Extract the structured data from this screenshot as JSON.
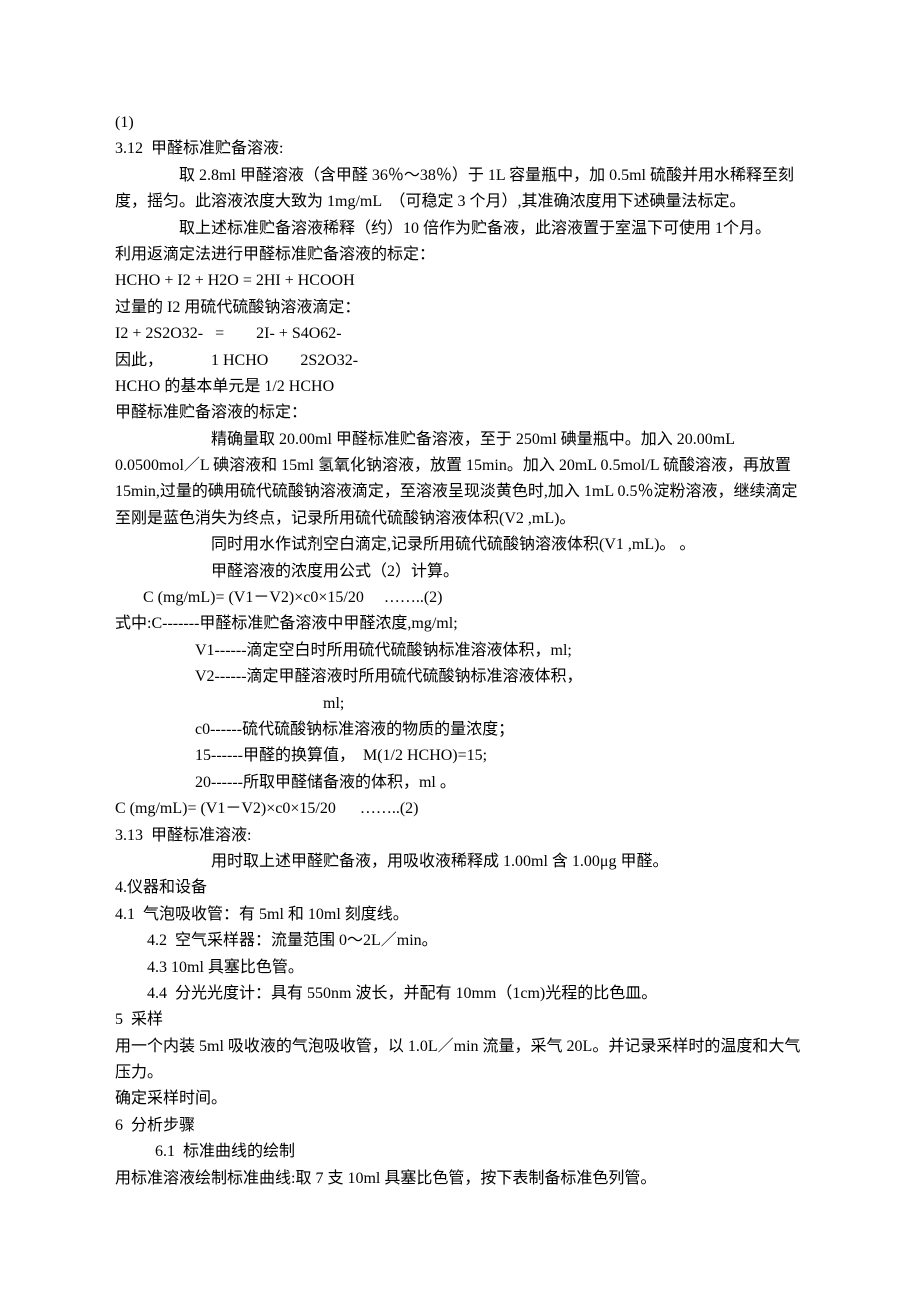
{
  "lines": {
    "l0": "(1)",
    "l1": "3.12  甲醛标准贮备溶液:",
    "l2": "　　　　取 2.8ml 甲醛溶液（含甲醛 36％～38％）于 1L 容量瓶中，加 0.5ml 硫酸并用水稀释至刻度，摇匀。此溶液浓度大致为 1mg/mL  （可稳定 3 个月）,其准确浓度用下述碘量法标定。",
    "l3": "",
    "l4": "　　　　取上述标准贮备溶液稀释（约）10 倍作为贮备液，此溶液置于室温下可使用 1个月。",
    "l5": "利用返滴定法进行甲醛标准贮备溶液的标定：",
    "l6": "HCHO + I2 + H2O = 2HI + HCOOH",
    "l7": "过量的 I2 用硫代硫酸钠溶液滴定：",
    "l8": "I2 + 2S2O32-   =        2I- + S4O62-",
    "l9": "因此，            1 HCHO        2S2O32-",
    "l10": "HCHO 的基本单元是 1/2 HCHO",
    "l11": "甲醛标准贮备溶液的标定：",
    "l12": "　　　　　　精确量取 20.00ml 甲醛标准贮备溶液，至于 250ml 碘量瓶中。加入 20.00mL 0.0500mol／L 碘溶液和 15ml 氢氧化钠溶液，放置 15min。加入 20mL 0.5mol/L 硫酸溶液，再放置 15min,过量的碘用硫代硫酸钠溶液滴定，至溶液呈现淡黄色时,加入 1mL 0.5％淀粉溶液，继续滴定至刚是蓝色消失为终点，记录所用硫代硫酸钠溶液体积(V2 ,mL)。",
    "l13": "　　　　　　同时用水作试剂空白滴定,记录所用硫代硫酸钠溶液体积(V1 ,mL)。 。",
    "l14": "　　　　　　甲醛溶液的浓度用公式（2）计算。",
    "l15": "       C (mg/mL)= (V1－V2)×c0×15/20     ……..(2)",
    "l16": "式中:C-------甲醛标准贮备溶液中甲醛浓度,mg/ml;",
    "l17": "　　　　　V1------滴定空白时所用硫代硫酸钠标准溶液体积，ml;",
    "l18": "　　　　　V2------滴定甲醛溶液时所用硫代硫酸钠标准溶液体积，",
    "l19": "　　　　　　　　　　　　　ml;",
    "l20": "　　　　　c0------硫代硫酸钠标准溶液的物质的量浓度；",
    "l21": "　　　　　15------甲醛的换算值，  M(1/2 HCHO)=15;",
    "l22": "　　　　　20------所取甲醛储备液的体积，ml 。",
    "l23": "C (mg/mL)= (V1－V2)×c0×15/20      ……..(2)",
    "l24": "3.13  甲醛标准溶液:",
    "l25": "　　　　　　用时取上述甲醛贮备液，用吸收液稀释成 1.00ml 含 1.00μg 甲醛。",
    "l26": "4.仪器和设备",
    "l27": "4.1  气泡吸收管：有 5ml 和 10ml 刻度线。",
    "l28": "　　4.2  空气采样器：流量范围 0～2L／min。",
    "l29": "　　4.3 10ml 具塞比色管。",
    "l30": "　　4.4  分光光度计：具有 550nm 波长，并配有 10mm（1cm)光程的比色皿。",
    "l31": "5  采样",
    "l32": "用一个内装 5ml 吸收液的气泡吸收管，以 1.0L／min 流量，采气 20L。并记录采样时的温度和大气压力。",
    "l33": "确定采样时间。",
    "l34": "6  分析步骤",
    "l35": "　　  6.1  标准曲线的绘制",
    "l36": "用标准溶液绘制标准曲线:取 7 支 10ml 具塞比色管，按下表制备标准色列管。"
  }
}
